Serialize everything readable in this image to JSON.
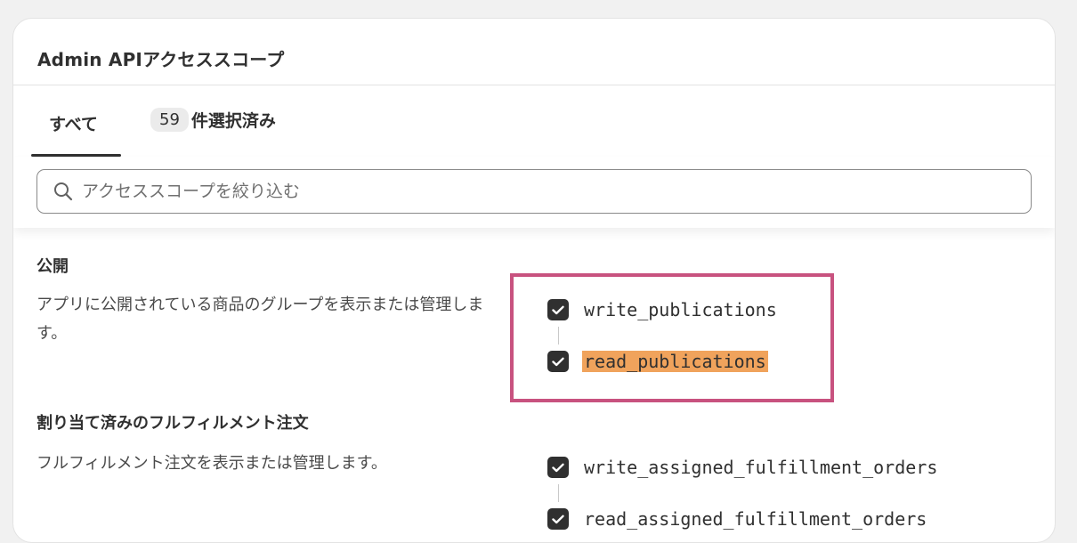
{
  "card": {
    "title": "Admin APIアクセススコープ"
  },
  "tabs": {
    "all_label": "すべて",
    "selected_count": "59",
    "selected_label": "件選択済み"
  },
  "search": {
    "placeholder": "アクセススコープを絞り込む",
    "value": ""
  },
  "sections": [
    {
      "title": "公開",
      "description": "アプリに公開されている商品のグループを表示または管理します。",
      "scopes": [
        {
          "name": "write_publications",
          "checked": true
        },
        {
          "name": "read_publications",
          "checked": true,
          "highlighted": true
        }
      ]
    },
    {
      "title": "割り当て済みのフルフィルメント注文",
      "description": "フルフィルメント注文を表示または管理します。",
      "scopes": [
        {
          "name": "write_assigned_fulfillment_orders",
          "checked": true
        },
        {
          "name": "read_assigned_fulfillment_orders",
          "checked": true
        }
      ]
    }
  ],
  "colors": {
    "text": "#303030",
    "highlight": "#f0a35c",
    "annotation_box": "#c8527f",
    "checkbox": "#303030"
  }
}
